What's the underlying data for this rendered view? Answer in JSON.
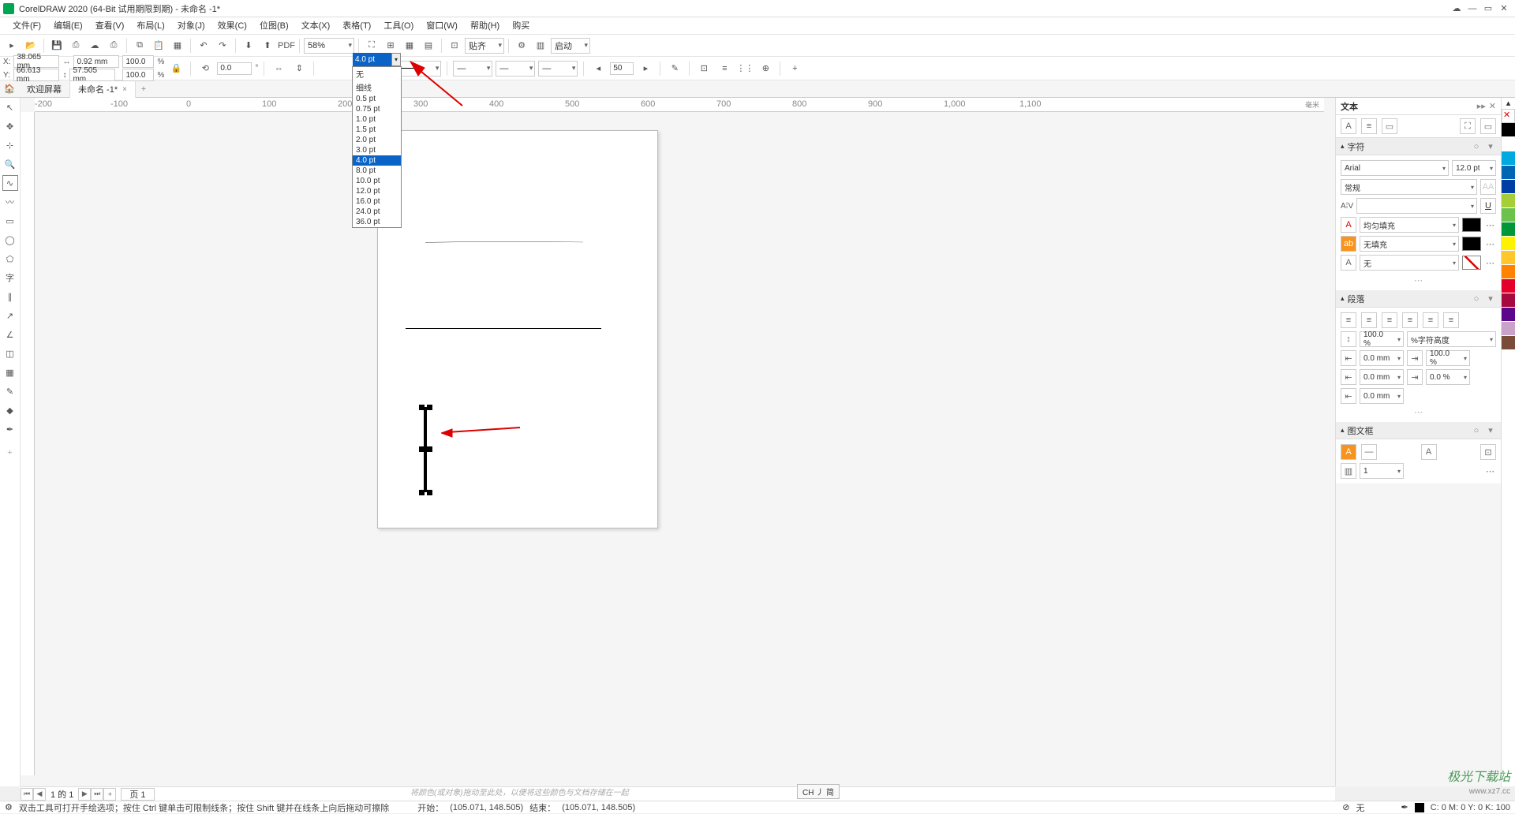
{
  "title": "CorelDRAW 2020 (64-Bit 试用期限到期) - 未命名 -1*",
  "menu": {
    "file": "文件(F)",
    "edit": "编辑(E)",
    "view": "查看(V)",
    "layout": "布局(L)",
    "object": "对象(J)",
    "effect": "效果(C)",
    "bitmap": "位图(B)",
    "text": "文本(X)",
    "table": "表格(T)",
    "tool": "工具(O)",
    "window": "窗口(W)",
    "help": "帮助(H)",
    "buy": "购买"
  },
  "tb1": {
    "zoom": "58%",
    "snap": "贴齐",
    "start": "启动"
  },
  "tb2": {
    "x_lbl": "X:",
    "y_lbl": "Y:",
    "x": "38.065 mm",
    "y": "66.613 mm",
    "w": "0.92 mm",
    "h": "57.505 mm",
    "sx": "100.0",
    "sy": "100.0",
    "pct": "%",
    "rot": "0.0",
    "deg": "°",
    "outline": "4.0 pt",
    "ext": "50"
  },
  "dropdown": {
    "items": [
      "无",
      "细线",
      "0.5 pt",
      "0.75 pt",
      "1.0 pt",
      "1.5 pt",
      "2.0 pt",
      "3.0 pt",
      "4.0 pt",
      "8.0 pt",
      "10.0 pt",
      "12.0 pt",
      "16.0 pt",
      "24.0 pt",
      "36.0 pt"
    ],
    "sel": 8
  },
  "tabs": {
    "welcome": "欢迎屏幕",
    "doc": "未命名 -1*"
  },
  "rpanel": {
    "title": "文本",
    "char": "字符",
    "para": "段落",
    "frame": "图文框",
    "font": "Arial",
    "size": "12.0 pt",
    "weight": "常规",
    "fill": "均匀填充",
    "bg": "无填充",
    "outline": "无",
    "ls": "100.0 %",
    "ls_unit": "%字符高度",
    "indent_l": "0.0 mm",
    "indent_r": "100.0 %",
    "indent_b": "0.0 mm",
    "indent_b2": "0.0 %",
    "sp": "0.0 mm",
    "cols": "1"
  },
  "ruler": {
    "h": [
      "-200",
      "-100",
      "0",
      "100",
      "200",
      "300",
      "400",
      "500",
      "600",
      "700",
      "800",
      "900",
      "1,000",
      "1,100"
    ],
    "unit": "毫米"
  },
  "pagebar": {
    "info": "1 的 1",
    "page": "页 1"
  },
  "ime": "CH 丿 简",
  "hint": "将颜色(或对象)拖动至此处，以便将这些颜色与文档存储在一起",
  "status": {
    "tip": "双击工具可打开手绘选项；按住 Ctrl 键单击可限制线条；按住 Shift 键并在线条上向后拖动可擦除",
    "start": "开始：",
    "startv": "(105.071, 148.505)",
    "end": "结束：",
    "endv": "(105.071, 148.505)",
    "fill": "无",
    "cmyk": "C: 0 M: 0 Y: 0 K: 100"
  },
  "colors": [
    "#000",
    "#fff",
    "#00a9e0",
    "#0066b3",
    "#003da5",
    "#a6ce39",
    "#6cc24a",
    "#009639",
    "#fff200",
    "#ffc72c",
    "#ff8200",
    "#e4002b",
    "#a6093d",
    "#5c068c",
    "#c8a2c8",
    "#7b4b3a"
  ],
  "watermark": "极光下载站",
  "watermark2": "www.xz7.cc"
}
